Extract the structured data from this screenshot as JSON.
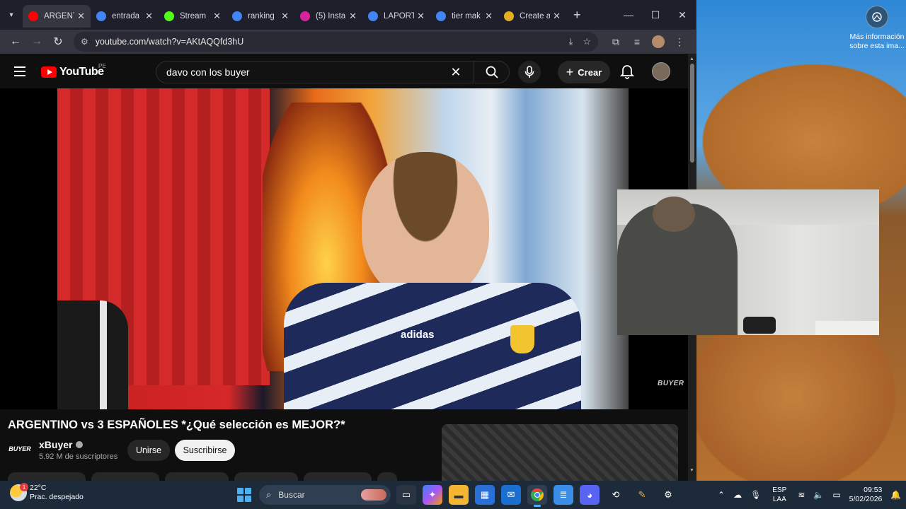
{
  "desktop": {
    "info_text": "Más información sobre esta ima..."
  },
  "browser": {
    "tabs": [
      {
        "label": "ARGENT",
        "favicon": "youtube-icon",
        "color": "#ff0000",
        "active": true
      },
      {
        "label": "entrada",
        "favicon": "google-icon",
        "color": "#4285f4",
        "active": false
      },
      {
        "label": "Stream",
        "favicon": "kick-icon",
        "color": "#53fc18",
        "active": false
      },
      {
        "label": "ranking",
        "favicon": "google-icon",
        "color": "#4285f4",
        "active": false
      },
      {
        "label": "(5) Insta",
        "favicon": "instagram-icon",
        "color": "#d6249f",
        "active": false
      },
      {
        "label": "LAPORT",
        "favicon": "google-icon",
        "color": "#4285f4",
        "active": false
      },
      {
        "label": "tier mak",
        "favicon": "google-icon",
        "color": "#4285f4",
        "active": false
      },
      {
        "label": "Create a",
        "favicon": "tiermaker-icon",
        "color": "#e0b020",
        "active": false
      }
    ],
    "url": "youtube.com/watch?v=AKtAQQfd3hU"
  },
  "youtube": {
    "logo_text": "YouTube",
    "country_code": "PE",
    "search_query": "davo con los buyer",
    "create_label": "Crear",
    "video_title": "ARGENTINO vs 3 ESPAÑOLES *¿Qué selección es MEJOR?*",
    "channel_name": "xBuyer",
    "channel_logo": "BUYER",
    "subscribers": "5.92 M de suscriptores",
    "join_label": "Unirse",
    "subscribe_label": "Suscribirse",
    "watermark": "BUYER",
    "video_jersey_text": "adidas"
  },
  "taskbar": {
    "weather_temp": "22°C",
    "weather_desc": "Prac. despejado",
    "weather_badge": "1",
    "search_placeholder": "Buscar",
    "lang_line1": "ESP",
    "lang_line2": "LAA",
    "time": "09:53",
    "date": "5/02/2026"
  }
}
